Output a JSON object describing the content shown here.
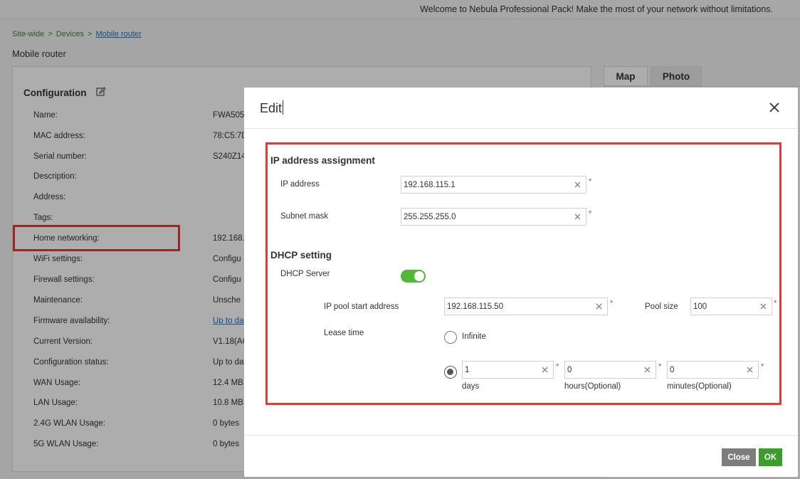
{
  "header": {
    "welcome": "Welcome to Nebula Professional Pack! Make the most of your network without limitations."
  },
  "breadcrumb": {
    "items": [
      "Site-wide",
      "Devices"
    ],
    "separator": ">",
    "current": "Mobile router"
  },
  "page_title": "Mobile router",
  "configuration": {
    "title": "Configuration",
    "rows": [
      {
        "label": "Name:",
        "value": "FWA505"
      },
      {
        "label": "MAC address:",
        "value": "78:C5:7D"
      },
      {
        "label": "Serial number:",
        "value": "S240Z14"
      },
      {
        "label": "Description:",
        "value": ""
      },
      {
        "label": "Address:",
        "value": ""
      },
      {
        "label": "Tags:",
        "value": ""
      },
      {
        "label": "Home networking:",
        "value": "192.168.1"
      },
      {
        "label": "WiFi settings:",
        "value": "Configu"
      },
      {
        "label": "Firewall settings:",
        "value": "Configu"
      },
      {
        "label": "Maintenance:",
        "value": "Unsche"
      },
      {
        "label": "Firmware availability:",
        "value": "Up to da"
      },
      {
        "label": "Current Version:",
        "value": "V1.18(AC"
      },
      {
        "label": "Configuration status:",
        "value": "Up to da"
      },
      {
        "label": "WAN Usage:",
        "value": "12.4 MB"
      },
      {
        "label": "LAN Usage:",
        "value": "10.8 MB"
      },
      {
        "label": "2.4G WLAN Usage:",
        "value": "0 bytes"
      },
      {
        "label": "5G WLAN Usage:",
        "value": "0 bytes"
      }
    ]
  },
  "tabs": {
    "map": "Map",
    "photo": "Photo"
  },
  "modal": {
    "title": "Edit",
    "ip_section": {
      "title": "IP address assignment",
      "ip_address_label": "IP address",
      "ip_address_value": "192.168.115.1",
      "subnet_label": "Subnet mask",
      "subnet_value": "255.255.255.0"
    },
    "dhcp_section": {
      "title": "DHCP setting",
      "server_label": "DHCP Server",
      "server_enabled": true,
      "pool_start_label": "IP pool start address",
      "pool_start_value": "192.168.115.50",
      "pool_size_label": "Pool size",
      "pool_size_value": "100",
      "lease_label": "Lease time",
      "infinite_label": "Infinite",
      "days_value": "1",
      "days_label": "days",
      "hours_value": "0",
      "hours_label": "hours(Optional)",
      "minutes_value": "0",
      "minutes_label": "minutes(Optional)"
    },
    "required_mark": "*",
    "close_label": "Close",
    "ok_label": "OK"
  },
  "colors": {
    "accent_green": "#53b83a",
    "ok_button": "#3c9e2a",
    "close_button": "#7d7d7d",
    "highlight_red": "#e53935",
    "link_blue": "#1a75c4"
  }
}
